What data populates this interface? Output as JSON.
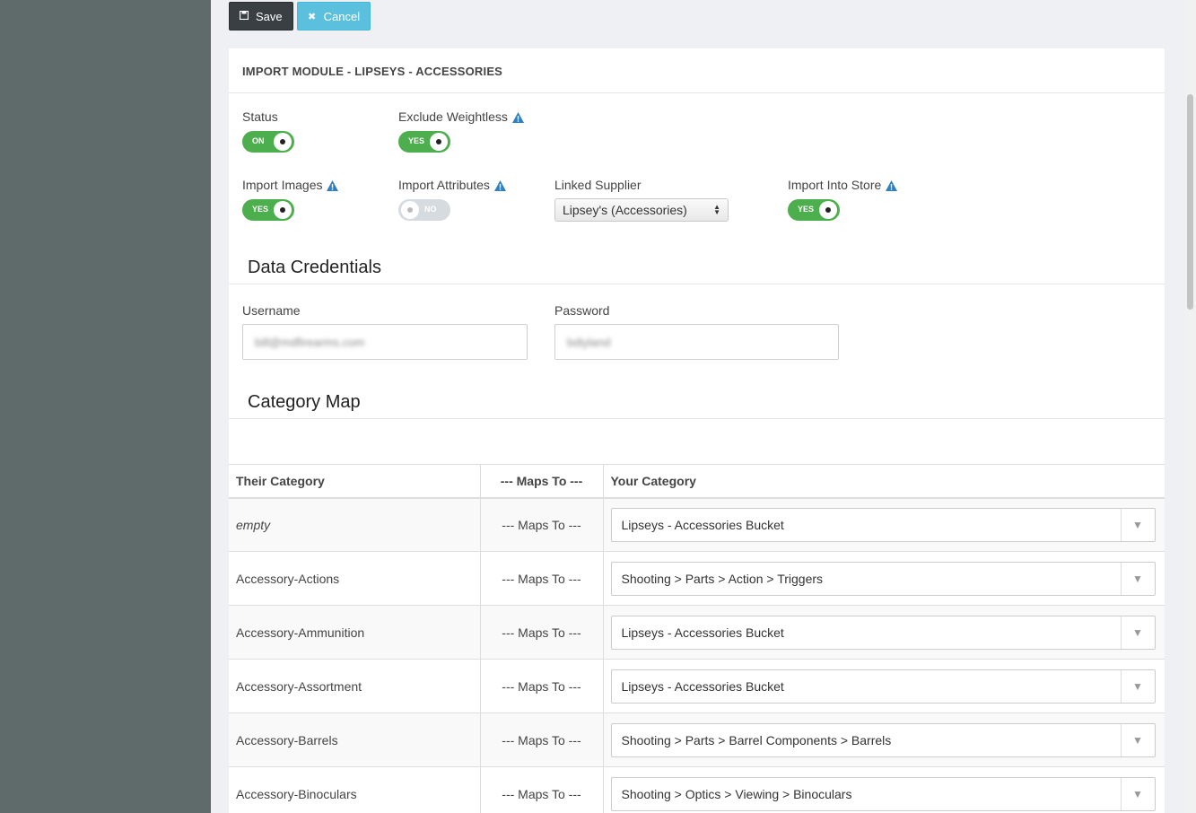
{
  "toolbar": {
    "save_label": "Save",
    "cancel_label": "Cancel"
  },
  "panel": {
    "title": "IMPORT MODULE - LIPSEYS - ACCESSORIES"
  },
  "settings": {
    "status": {
      "label": "Status",
      "toggle": "ON",
      "on": true
    },
    "exclude_weightless": {
      "label": "Exclude Weightless",
      "toggle": "YES",
      "on": true
    },
    "import_images": {
      "label": "Import Images",
      "toggle": "YES",
      "on": true
    },
    "import_attributes": {
      "label": "Import Attributes",
      "toggle": "NO",
      "on": false
    },
    "linked_supplier": {
      "label": "Linked Supplier",
      "value": "Lipsey's (Accessories)"
    },
    "import_into_store": {
      "label": "Import Into Store",
      "toggle": "YES",
      "on": true
    }
  },
  "credentials": {
    "title": "Data Credentials",
    "username_label": "Username",
    "username_value": "bill@mdfirearms.com",
    "password_label": "Password",
    "password_value": "bdiyland"
  },
  "category_map": {
    "title": "Category Map",
    "headers": {
      "their_category": "Their Category",
      "maps_to": "--- Maps To ---",
      "your_category": "Your Category"
    },
    "rows": [
      {
        "their": "empty",
        "maps": "--- Maps To ---",
        "yours": "Lipseys - Accessories Bucket"
      },
      {
        "their": "Accessory-Actions",
        "maps": "--- Maps To ---",
        "yours": "Shooting > Parts > Action > Triggers"
      },
      {
        "their": "Accessory-Ammunition",
        "maps": "--- Maps To ---",
        "yours": "Lipseys - Accessories Bucket"
      },
      {
        "their": "Accessory-Assortment",
        "maps": "--- Maps To ---",
        "yours": "Lipseys - Accessories Bucket"
      },
      {
        "their": "Accessory-Barrels",
        "maps": "--- Maps To ---",
        "yours": "Shooting > Parts > Barrel Components > Barrels"
      },
      {
        "their": "Accessory-Binoculars",
        "maps": "--- Maps To ---",
        "yours": "Shooting > Optics > Viewing > Binoculars"
      }
    ]
  },
  "colors": {
    "sidebar": "#5f6b6b",
    "toggle_on": "#4cae4c",
    "info_icon": "#2f7fc1",
    "cancel_button": "#5bc0de"
  }
}
